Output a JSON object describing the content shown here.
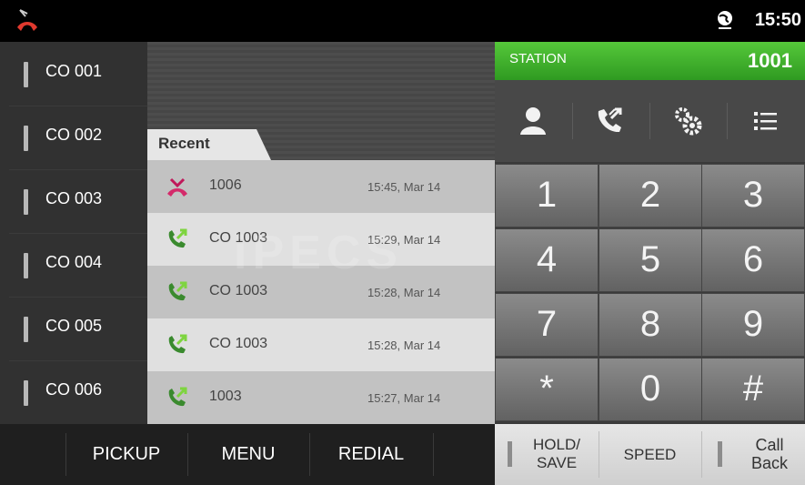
{
  "status_bar": {
    "time": "15:50",
    "icons": [
      "missed-call-icon",
      "globe-icon"
    ]
  },
  "co_lines": [
    "CO 001",
    "CO 002",
    "CO 003",
    "CO 004",
    "CO 005",
    "CO 006"
  ],
  "recent": {
    "tab_label": "Recent",
    "watermark": "iPECS",
    "rows": [
      {
        "type": "missed",
        "number": "1006",
        "time": "15:45, Mar 14"
      },
      {
        "type": "outgoing",
        "number": "CO 1003",
        "time": "15:29, Mar 14"
      },
      {
        "type": "outgoing",
        "number": "CO 1003",
        "time": "15:28, Mar 14"
      },
      {
        "type": "outgoing",
        "number": "CO 1003",
        "time": "15:28, Mar 14"
      },
      {
        "type": "outgoing",
        "number": "1003",
        "time": "15:27, Mar 14"
      }
    ]
  },
  "station": {
    "label": "STATION",
    "number": "1001",
    "bar_color": "#3fae2a"
  },
  "toolbar_icons": [
    "contact-icon",
    "call-log-icon",
    "settings-icon",
    "menu-list-icon"
  ],
  "keypad": [
    "1",
    "2",
    "3",
    "4",
    "5",
    "6",
    "7",
    "8",
    "9",
    "*",
    "0",
    "#"
  ],
  "bottom_left": {
    "pickup": "PICKUP",
    "menu": "MENU",
    "redial": "REDIAL"
  },
  "bottom_right": {
    "hold_line1": "HOLD/",
    "hold_line2": "SAVE",
    "speed": "SPEED",
    "callback_line1": "Call",
    "callback_line2": "Back"
  }
}
